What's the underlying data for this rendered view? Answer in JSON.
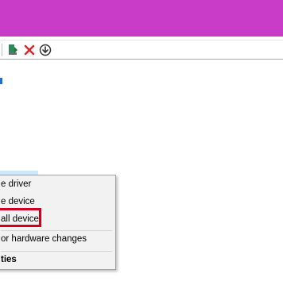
{
  "window": {
    "accent_color": "#c83cc8"
  },
  "toolbar": {
    "buttons": [
      {
        "icon": "update-driver-icon"
      },
      {
        "icon": "uninstall-icon"
      },
      {
        "icon": "download-icon"
      }
    ]
  },
  "context_menu": {
    "items": [
      {
        "label": "e driver"
      },
      {
        "label": "e device"
      },
      {
        "label": "all device"
      },
      {
        "label": "or hardware changes"
      },
      {
        "label": "ties"
      }
    ],
    "highlight_color": "#d0021b"
  }
}
